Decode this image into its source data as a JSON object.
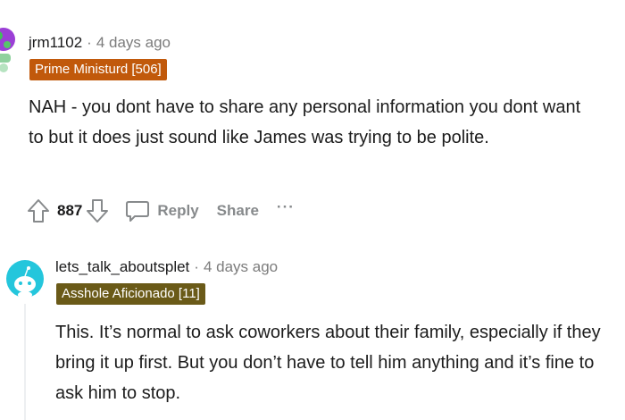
{
  "comments": [
    {
      "username": "jrm1102",
      "separator": "·",
      "timestamp": "4 days ago",
      "flair": "Prime Ministurd [506]",
      "flair_color": "#c1590b",
      "body": "NAH - you dont have to share any personal information you dont want to but it does just sound like James was trying to be polite.",
      "votes": "887",
      "reply_label": "Reply",
      "share_label": "Share",
      "more_label": "···"
    },
    {
      "username": "lets_talk_aboutsplet",
      "separator": "·",
      "timestamp": "4 days ago",
      "flair": "Asshole Aficionado [11]",
      "flair_color": "#6a5a18",
      "body": "This. It’s normal to ask coworkers about their family, especially if they bring it up first. But you don’t have to tell him anything and it’s fine to ask him to stop."
    }
  ],
  "icons": {
    "upvote": "arrow-up-icon",
    "downvote": "arrow-down-icon",
    "reply": "comment-bubble-icon",
    "avatar1": "avatar",
    "avatar2": "snoo-avatar"
  }
}
